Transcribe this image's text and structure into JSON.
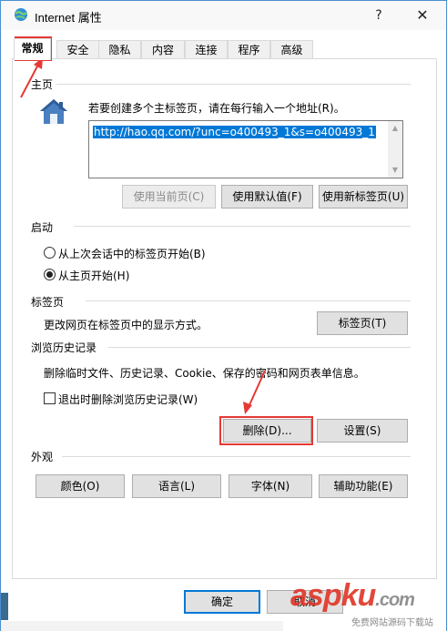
{
  "window": {
    "title": "Internet 属性",
    "help_label": "?",
    "close_label": "✕"
  },
  "tabs": [
    {
      "label": "常规",
      "active": true
    },
    {
      "label": "安全"
    },
    {
      "label": "隐私"
    },
    {
      "label": "内容"
    },
    {
      "label": "连接"
    },
    {
      "label": "程序"
    },
    {
      "label": "高级"
    }
  ],
  "homepage": {
    "section": "主页",
    "description": "若要创建多个主标签页，请在每行输入一个地址(R)。",
    "url": "http://hao.qq.com/?unc=o400493_1&s=o400493_1",
    "buttons": {
      "use_current": "使用当前页(C)",
      "use_default": "使用默认值(F)",
      "use_new_tab": "使用新标签页(U)"
    }
  },
  "startup": {
    "section": "启动",
    "option_last_session": "从上次会话中的标签页开始(B)",
    "option_homepage": "从主页开始(H)",
    "selected": "homepage"
  },
  "tabs_section": {
    "section": "标签页",
    "description": "更改网页在标签页中的显示方式。",
    "button": "标签页(T)"
  },
  "history": {
    "section": "浏览历史记录",
    "description": "删除临时文件、历史记录、Cookie、保存的密码和网页表单信息。",
    "delete_on_exit": "退出时删除浏览历史记录(W)",
    "delete_button": "删除(D)...",
    "settings_button": "设置(S)"
  },
  "appearance": {
    "section": "外观",
    "colors": "颜色(O)",
    "languages": "语言(L)",
    "fonts": "字体(N)",
    "accessibility": "辅助功能(E)"
  },
  "footer": {
    "ok": "确定",
    "cancel": "取消"
  },
  "watermark": {
    "brand": "aspku",
    "tld": ".com",
    "subtitle": "免费网站源码下载站"
  },
  "colors": {
    "accent": "#0078d7",
    "highlight_red": "#e53935"
  }
}
